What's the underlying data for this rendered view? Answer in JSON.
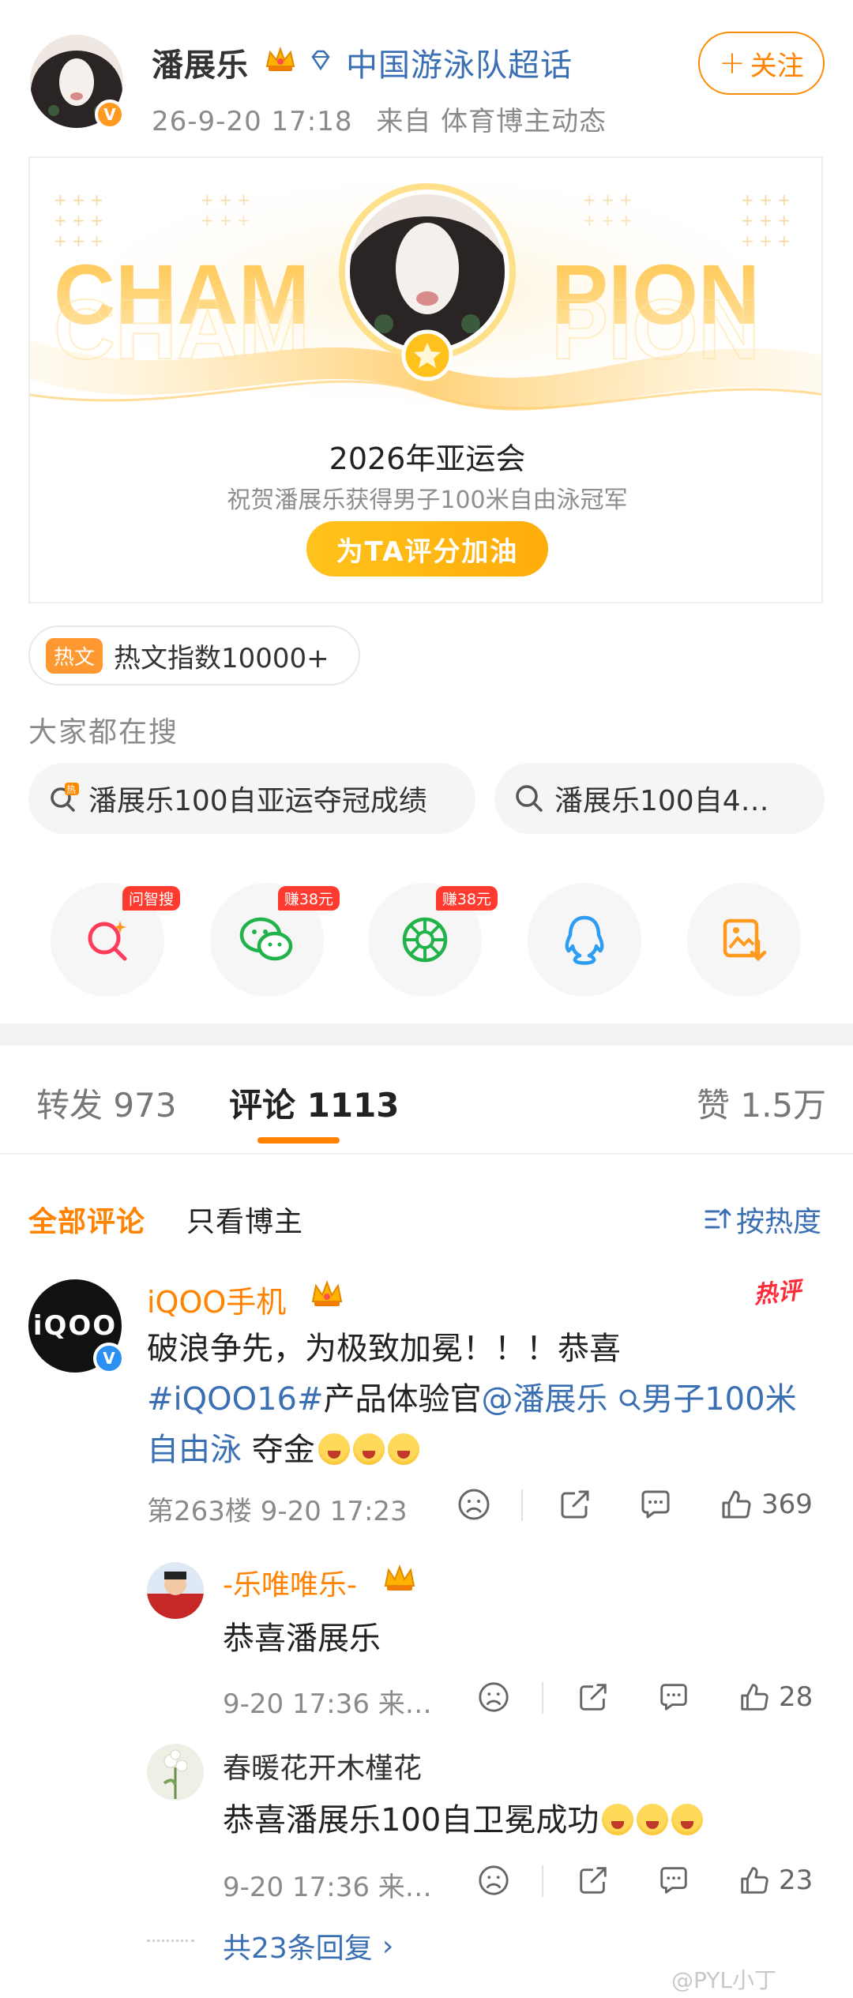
{
  "post": {
    "author": "潘展乐",
    "topic": "中国游泳队超话",
    "time": "26-9-20 17:18",
    "source": "来自 体育博主动态",
    "follow_label": "关注"
  },
  "card": {
    "word_left": "CHAM",
    "word_right": "PION",
    "title": "2026年亚运会",
    "subtitle": "祝贺潘展乐获得男子100米自由泳冠军",
    "button": "为TA评分加油"
  },
  "hot": {
    "tag": "热文",
    "text": "热文指数10000+"
  },
  "search": {
    "heading": "大家都在搜",
    "chips": [
      "潘展乐100自亚运夺冠成绩",
      "潘展乐100自4…"
    ]
  },
  "share": {
    "badges": [
      "问智搜",
      "赚38元",
      "赚38元"
    ]
  },
  "tabs": {
    "repost": "转发 973",
    "comment": "评论 1113",
    "like": "赞 1.5万"
  },
  "filters": {
    "all": "全部评论",
    "blogger": "只看博主",
    "sort": "按热度"
  },
  "comment": {
    "avatar_text": "iQOO",
    "name": "iQOO手机",
    "hot_stamp": "热评",
    "text_1": "破浪争先，为极致加冕！！！恭喜",
    "hashtag": "#iQOO16#",
    "text_2": "产品体验官",
    "mention": "@潘展乐",
    "search_term": "男子100米自由泳",
    "text_3": "夺金",
    "meta": "第263楼  9-20 17:23",
    "likes": "369"
  },
  "replies": [
    {
      "name": "-乐唯唯乐-",
      "text": "恭喜潘展乐",
      "meta": "9-20 17:36  来…",
      "likes": "28"
    },
    {
      "name": "春暖花开木槿花",
      "text": "恭喜潘展乐100自卫冕成功",
      "meta": "9-20 17:36  来…",
      "likes": "23"
    }
  ],
  "more_replies": "共23条回复",
  "watermark": "@PYL小丁",
  "colors": {
    "accent": "#ff8200",
    "link": "#3a6fb3",
    "gold": "#ffb800"
  }
}
